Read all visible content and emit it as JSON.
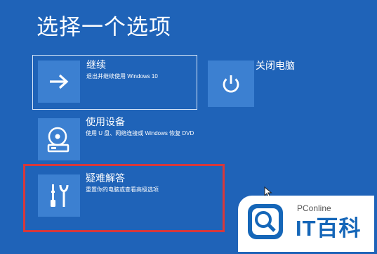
{
  "screen": {
    "title": "选择一个选项",
    "background_color": "#1f63b8",
    "tile_color": "#3c80d1"
  },
  "options": {
    "continue": {
      "name": "继续",
      "description": "退出并继续使用 Windows 10",
      "icon": "arrow-right-icon"
    },
    "use_device": {
      "name": "使用设备",
      "description": "使用 U 盘、网络连接或 Windows 恢复 DVD",
      "icon": "disc-drive-icon"
    },
    "troubleshoot": {
      "name": "疑难解答",
      "description": "重置你的电脑或查看高级选项",
      "icon": "tools-icon"
    },
    "shutdown": {
      "name": "关闭电脑",
      "icon": "power-icon"
    }
  },
  "annotation": {
    "highlight_color": "#d7383b"
  },
  "watermark": {
    "brand": "PConline",
    "logo_text": "IT百科",
    "color": "#1566b8"
  }
}
